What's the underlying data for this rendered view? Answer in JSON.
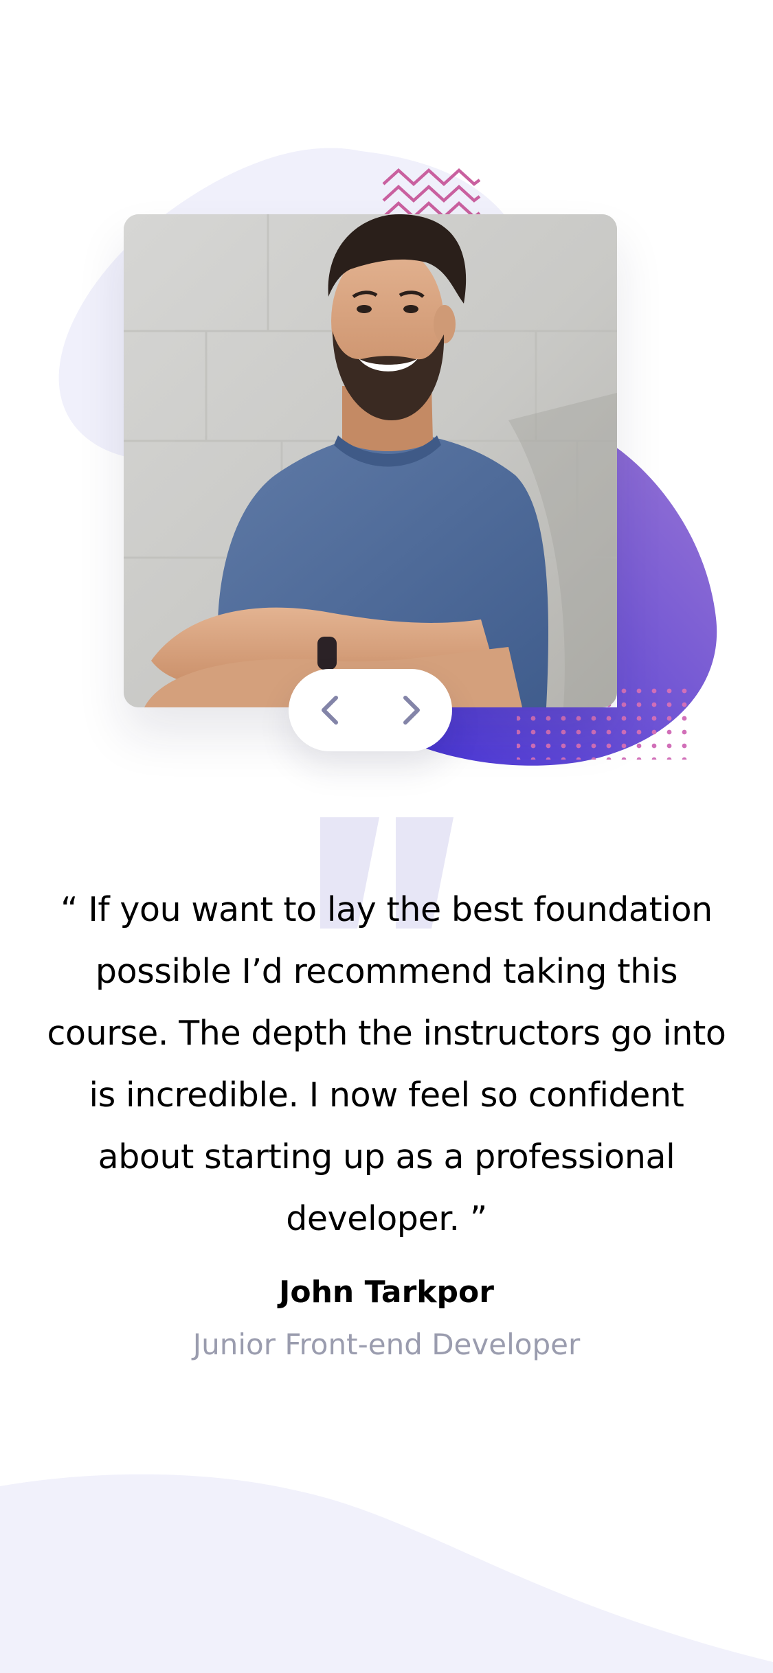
{
  "testimonial": {
    "quote": "“ If you want to lay the best foundation possible I’d recommend taking this course. The depth the instructors go into is incredible. I now feel so confident about starting up as a professional developer. ”",
    "author_name": "John Tarkpor",
    "author_role": "Junior Front-end Developer"
  },
  "navigation": {
    "prev_icon": "chevron-left-icon",
    "next_icon": "chevron-right-icon"
  },
  "colors": {
    "page_background": "#ffffff",
    "accent_purple": "#6b4ad3",
    "accent_pink": "#c0559b",
    "soft_lavender": "#f1f1fb",
    "quote_mark": "#e7e6f6",
    "icon_gray": "#8384a8",
    "role_text": "#9a9cae"
  }
}
